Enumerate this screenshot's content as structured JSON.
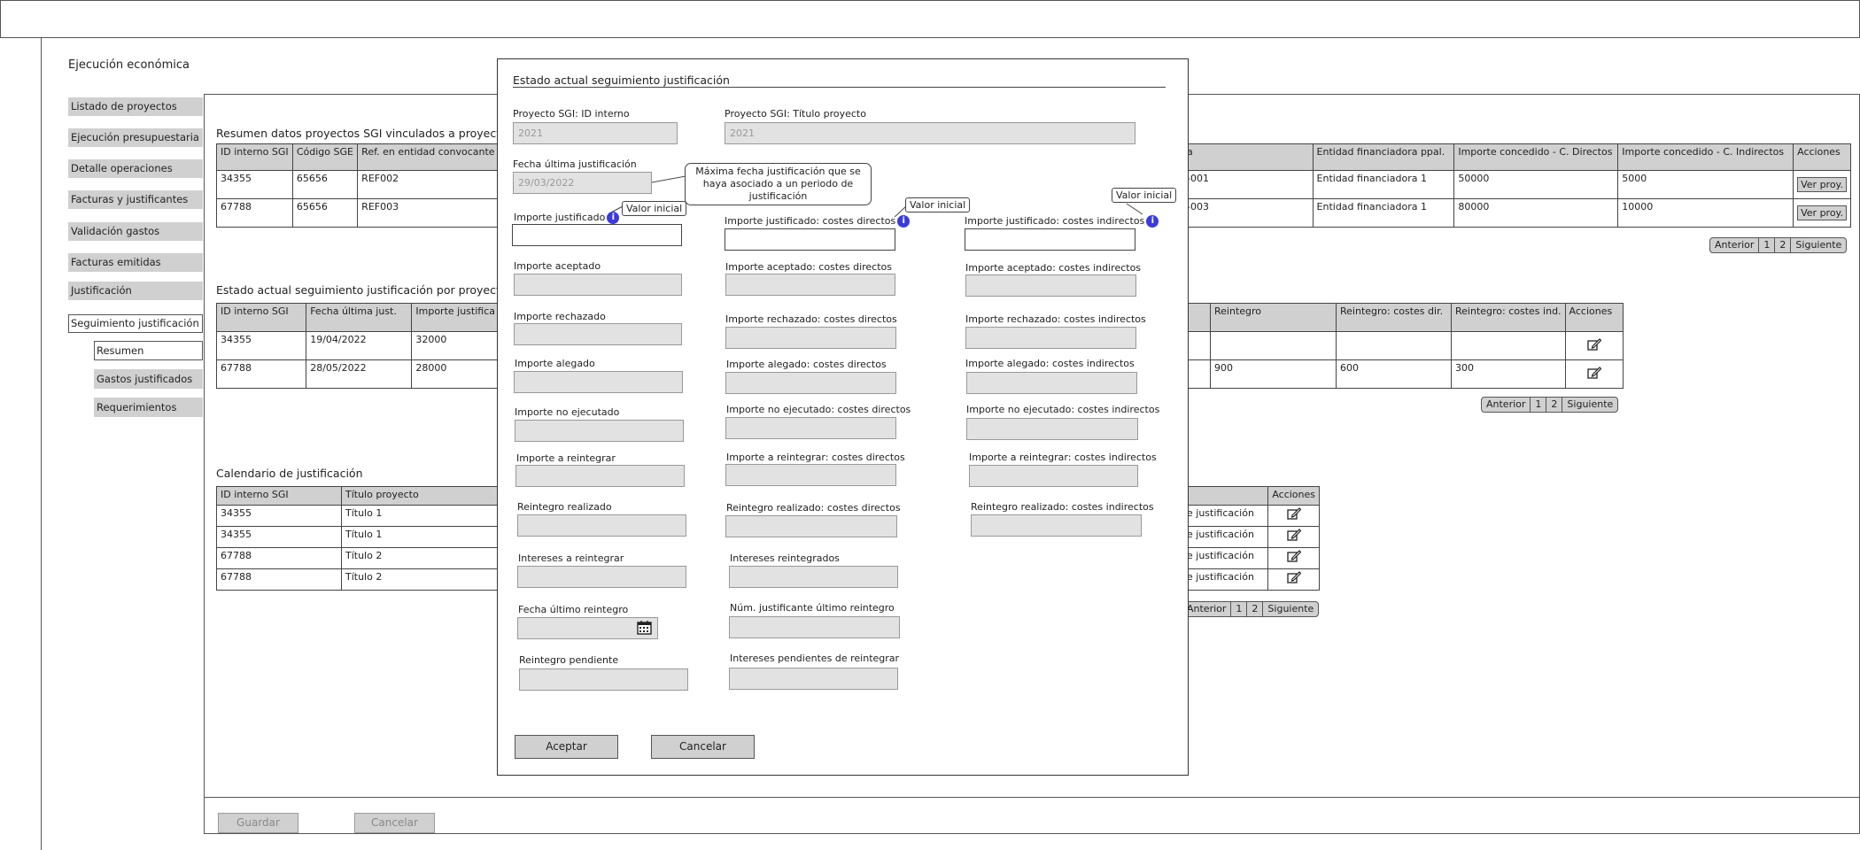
{
  "page_title": "Ejecución económica",
  "nav": {
    "items": [
      {
        "label": "Listado de proyectos"
      },
      {
        "label": "Ejecución presupuestaria"
      },
      {
        "label": "Detalle operaciones"
      },
      {
        "label": "Facturas y justificantes"
      },
      {
        "label": "Validación gastos"
      },
      {
        "label": "Facturas emitidas"
      },
      {
        "label": "Justificación"
      },
      {
        "label": "Seguimiento justificación"
      }
    ],
    "sub_items": [
      {
        "label": "Resumen"
      },
      {
        "label": "Gastos justificados"
      },
      {
        "label": "Requerimientos"
      }
    ]
  },
  "section1": {
    "title": "Resumen datos proyectos SGI vinculados a proyecto SGE",
    "left_headers": [
      "ID interno SGI",
      "Código SGE",
      "Ref. en entidad convocante"
    ],
    "left_rows": [
      [
        "34355",
        "65656",
        "REF002"
      ],
      [
        "67788",
        "65656",
        "REF003"
      ]
    ],
    "right_headers": [
      "a",
      "Entidad financiadora ppal.",
      "Importe concedido - C. Directos",
      "Importe concedido - C. Indirectos",
      "Acciones"
    ],
    "right_rows": [
      [
        "-001",
        "Entidad financiadora 1",
        "50000",
        "5000"
      ],
      [
        "-003",
        "Entidad financiadora 1",
        "80000",
        "10000"
      ]
    ],
    "action_label": "Ver proy."
  },
  "section2": {
    "title": "Estado actual seguimiento justificación por proyecto SGI",
    "left_headers": [
      "ID interno SGI",
      "Fecha última just.",
      "Importe justifica"
    ],
    "left_rows": [
      [
        "34355",
        "19/04/2022",
        "32000"
      ],
      [
        "67788",
        "28/05/2022",
        "28000"
      ]
    ],
    "right_headers": [
      "",
      "Reintegro",
      "Reintegro: costes dir.",
      "Reintegro: costes ind.",
      "Acciones"
    ],
    "right_rows": [
      [
        "",
        "",
        "",
        ""
      ],
      [
        "",
        "900",
        "600",
        "300"
      ]
    ]
  },
  "section3": {
    "title": "Calendario de justificación",
    "left_headers": [
      "ID interno SGI",
      "Título proyecto"
    ],
    "left_rows": [
      [
        "34355",
        "Título 1"
      ],
      [
        "34355",
        "Título 1"
      ],
      [
        "67788",
        "Título 2"
      ],
      [
        "67788",
        "Título 2"
      ]
    ],
    "right_headers": [
      "",
      "Acciones"
    ],
    "right_rows": [
      "e justificación",
      "e justificación",
      "e justificación",
      "e justificación"
    ]
  },
  "pagination": {
    "prev": "Anterior",
    "pages": [
      "1",
      "2"
    ],
    "next": "Siguiente"
  },
  "footer": {
    "save": "Guardar",
    "cancel": "Cancelar"
  },
  "modal": {
    "title": "Estado actual seguimiento justificación",
    "id_label": "Proyecto SGI: ID interno",
    "id_value": "2021",
    "titulo_label": "Proyecto SGI: Título proyecto",
    "titulo_value": "2021",
    "fecha_label": "Fecha última justificación",
    "fecha_value": "29/03/2022",
    "fecha_callout": "Máxima fecha justificación que se haya asociado a un periodo de justificación",
    "tooltip": "Valor inicial",
    "col1": [
      "Importe justificado",
      "Importe aceptado",
      "Importe rechazado",
      "Importe alegado",
      "Importe no ejecutado",
      "Importe a reintegrar",
      "Reintegro realizado",
      "Intereses a reintegrar",
      "Fecha último reintegro",
      "Reintegro pendiente"
    ],
    "col2": [
      "Importe justificado: costes directos",
      "Importe aceptado: costes directos",
      "Importe rechazado: costes directos",
      "Importe alegado: costes directos",
      "Importe no ejecutado: costes directos",
      "Importe a reintegrar: costes directos",
      "Reintegro realizado: costes directos",
      "Intereses reintegrados",
      "Núm. justificante último reintegro",
      "Intereses pendientes de reintegrar"
    ],
    "col3": [
      "Importe justificado: costes indirectos",
      "Importe aceptado: costes indirectos",
      "Importe rechazado: costes indirectos",
      "Importe alegado: costes indirectos",
      "Importe no ejecutado: costes indirectos",
      "Importe a reintegrar: costes indirectos",
      "Reintegro realizado: costes indirectos"
    ],
    "accept": "Aceptar",
    "cancel": "Cancelar"
  },
  "colors": {
    "panel_gray": "#d0d0d0",
    "field_gray": "#e2e2e2",
    "info_blue": "#3b3bd9"
  },
  "icons": [
    "info-icon",
    "calendar-icon",
    "edit-icon"
  ]
}
